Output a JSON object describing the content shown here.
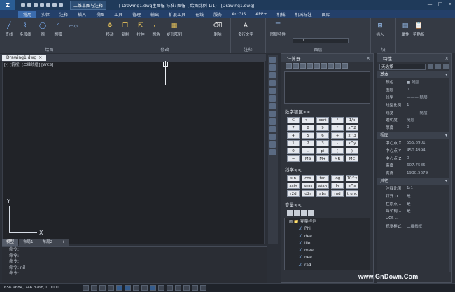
{
  "app": {
    "logo": "Z",
    "workspace": "二维草图与注释",
    "title": "[ Drawing1.dwg主图幅  标准: 图幅-[ 绘图比例 1:1) - [Drawing1.dwg]"
  },
  "menu": [
    "常用",
    "实体",
    "注释",
    "插入",
    "视图",
    "工具",
    "管理",
    "输出",
    "扩展工具",
    "在线",
    "服务",
    "ArcGIS",
    "APP+",
    "机械",
    "机械标注",
    "图库"
  ],
  "menu_active": 0,
  "ribbon": {
    "draw": {
      "label": "绘图",
      "buttons": [
        "直线",
        "多段线",
        "圆",
        "圆弧"
      ]
    },
    "modify": {
      "label": "修改",
      "buttons": [
        "移动",
        "复制",
        "拉伸",
        "圆角",
        "矩形阵列",
        "删除"
      ]
    },
    "annotation": {
      "label": "注释",
      "buttons": [
        "多行文字"
      ]
    },
    "layer": {
      "label": "图层",
      "buttons": [
        "图层特性"
      ],
      "current": "0"
    },
    "block": {
      "label": "块",
      "buttons": [
        "插入"
      ]
    },
    "extra": {
      "buttons": [
        "属性",
        "剪贴板"
      ]
    }
  },
  "doc_tab": "Drawing1.dwg",
  "viewport_label": "[-] [俯视] [二维线框] [WCS]",
  "ucs": {
    "x": "X",
    "y": "Y"
  },
  "layout_tabs": [
    "模型",
    "布局1",
    "布局2",
    "+"
  ],
  "command_lines": [
    "命令:",
    "命令:",
    "命令:",
    "命令: nil",
    "命令:"
  ],
  "status": {
    "coords": "656.9684,  746.3268,  0.0000"
  },
  "calculator": {
    "title": "计算器",
    "close": "×",
    "numpad_title": "数字键区<<",
    "numpad": [
      "C",
      "<---",
      "sqrt",
      "/",
      "1/x",
      "7",
      "8",
      "9",
      "*",
      "x^2",
      "4",
      "5",
      "6",
      "+",
      "x^3",
      "1",
      "2",
      "3",
      "-",
      "x^y",
      "0",
      ".",
      "pi",
      "(",
      ")",
      "=",
      "MS",
      "M+",
      "MR",
      "MC"
    ],
    "sci_title": "科学<<",
    "sci": [
      "sin",
      "cos",
      "tan",
      "log",
      "10^x",
      "asin",
      "acos",
      "atan",
      "ln",
      "e^x",
      "r2d",
      "d2r",
      "abs",
      "rnd",
      "trunc"
    ],
    "vars_title": "变量<<",
    "vars_root": "变量样例",
    "vars": [
      "Phi",
      "dee",
      "ille",
      "mee",
      "nee",
      "rad"
    ]
  },
  "properties": {
    "title": "特性",
    "close": "×",
    "selection": "无选择",
    "basic_title": "基本",
    "basic": [
      {
        "k": "颜色",
        "v": "■ 随层"
      },
      {
        "k": "图层",
        "v": "0"
      },
      {
        "k": "线型",
        "v": "——— 随层"
      },
      {
        "k": "线型比例",
        "v": "1"
      },
      {
        "k": "线宽",
        "v": "——— 随层"
      },
      {
        "k": "透明度",
        "v": "随层"
      },
      {
        "k": "厚度",
        "v": "0"
      }
    ],
    "view_title": "视图",
    "view": [
      {
        "k": "中心点 X",
        "v": "555.8901"
      },
      {
        "k": "中心点 Y",
        "v": "450.4994"
      },
      {
        "k": "中心点 Z",
        "v": "0"
      },
      {
        "k": "高度",
        "v": "607.7585"
      },
      {
        "k": "宽度",
        "v": "1930.5679"
      }
    ],
    "other_title": "其他",
    "other": [
      {
        "k": "注释比例",
        "v": "1:1"
      },
      {
        "k": "打开 U...",
        "v": "是"
      },
      {
        "k": "在原点...",
        "v": "是"
      },
      {
        "k": "每个视...",
        "v": "是"
      },
      {
        "k": "UCS ...",
        "v": ""
      },
      {
        "k": "视觉样式",
        "v": "二维线框"
      }
    ]
  },
  "watermark": "www.GnDown.Com",
  "colors": {
    "accent": "#3b6cae",
    "titlebar": "#1f3a5a",
    "panel": "#2f333b"
  }
}
